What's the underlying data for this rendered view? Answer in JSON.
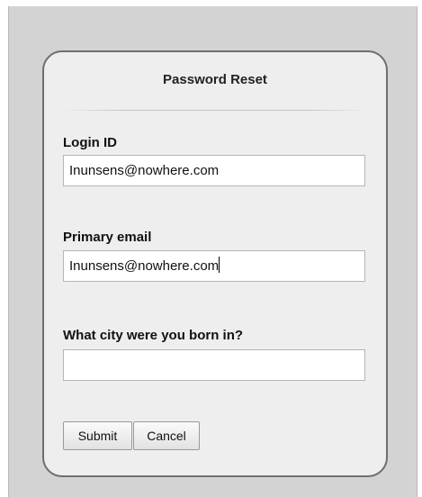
{
  "form": {
    "title": "Password Reset",
    "login_id": {
      "label": "Login ID",
      "value": "Inunsens@nowhere.com"
    },
    "primary_email": {
      "label": "Primary email",
      "value": "Inunsens@nowhere.com"
    },
    "security_question": {
      "label": "What city were you born in?",
      "value": ""
    },
    "buttons": {
      "submit_label": "Submit",
      "cancel_label": "Cancel"
    }
  }
}
